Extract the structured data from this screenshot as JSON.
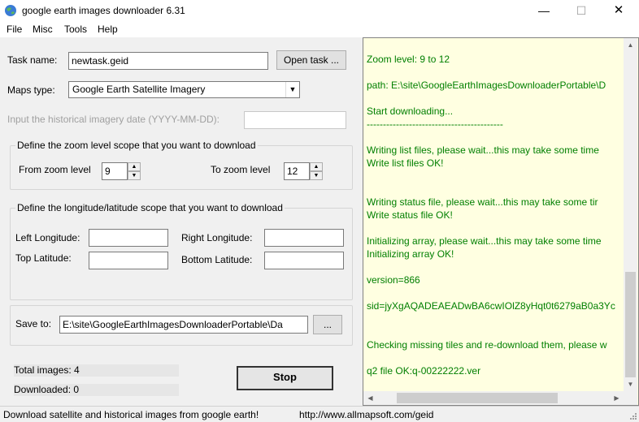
{
  "window": {
    "title": "google earth images downloader 6.31",
    "minimize": "—",
    "maximize": "☐",
    "close": "✕"
  },
  "menu": [
    "File",
    "Misc",
    "Tools",
    "Help"
  ],
  "form": {
    "task_name_label": "Task name:",
    "task_name_value": "newtask.geid",
    "open_task_button": "Open task ...",
    "maps_type_label": "Maps type:",
    "maps_type_value": "Google Earth Satellite Imagery",
    "hist_date_label": "Input the  historical imagery date (YYYY-MM-DD):",
    "hist_date_value": "",
    "zoom_group_title": "Define the zoom level scope that you want to download",
    "from_zoom_label": "From zoom level",
    "from_zoom_value": "9",
    "to_zoom_label": "To zoom level",
    "to_zoom_value": "12",
    "coord_group_title": "Define the longitude/latitude scope that you want to download",
    "left_lon_label": "Left Longitude:",
    "left_lon_value": "",
    "right_lon_label": "Right Longitude:",
    "right_lon_value": "",
    "top_lat_label": "Top Latitude:",
    "top_lat_value": "",
    "bottom_lat_label": "Bottom Latitude:",
    "bottom_lat_value": "",
    "save_to_label": "Save to:",
    "save_to_value": "E:\\site\\GoogleEarthImagesDownloaderPortable\\Da",
    "browse_button": "...",
    "total_images": "Total images: 4",
    "downloaded": "Downloaded: 0",
    "stop_button": "Stop"
  },
  "log": [
    "Zoom level: 9 to 12",
    "path: E:\\site\\GoogleEarthImagesDownloaderPortable\\D",
    "Start downloading...",
    "------------------------------------------",
    "Writing list files, please wait...this may take some time",
    "Write list files OK!",
    "Writing status file, please wait...this may take some tir",
    "Write status file OK!",
    "Initializing array, please wait...this may take some time",
    "Initializing array OK!",
    "version=866",
    "sid=jyXgAQADEAEADwBA6cwIOlZ8yHqt0t6279aB0a3Yc",
    "Checking missing tiles and re-download them, please w",
    "q2 file OK:q-00222222.ver"
  ],
  "status": {
    "left": "Download satellite and historical  images from google earth!",
    "right": "http://www.allmapsoft.com/geid"
  },
  "colors": {
    "log_text": "#007f00",
    "log_bg": "#ffffe1"
  }
}
